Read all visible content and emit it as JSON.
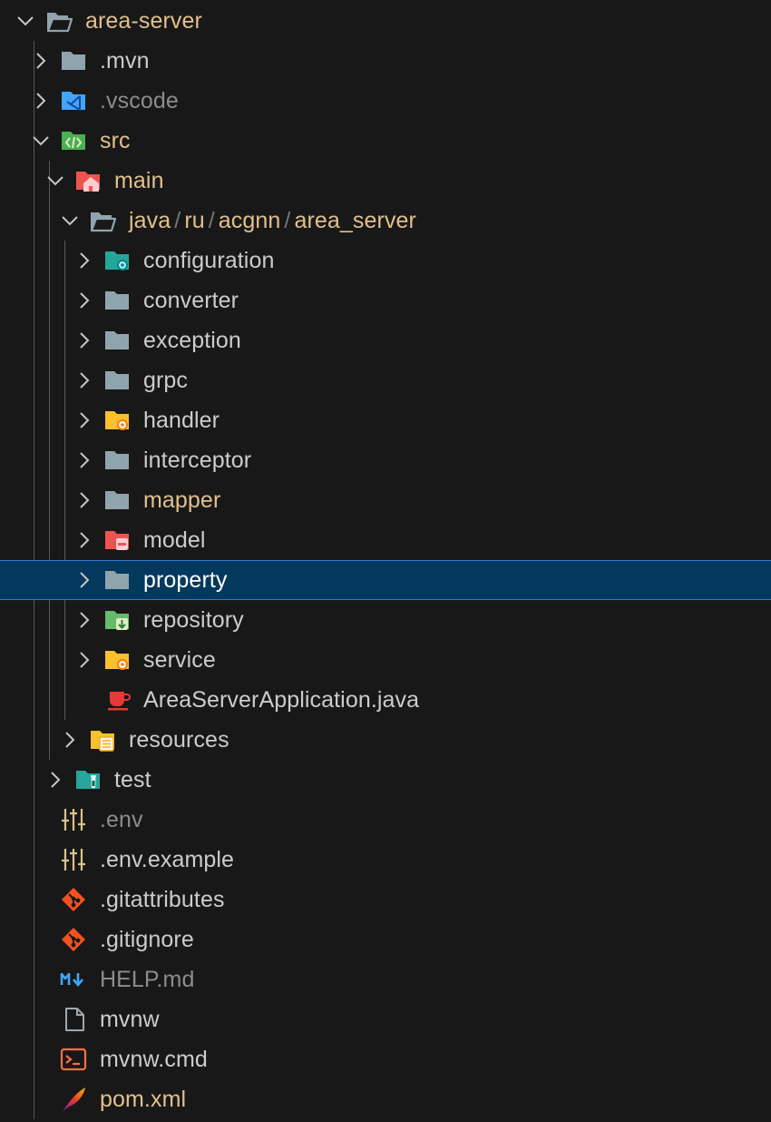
{
  "explorer": {
    "root": {
      "label": "area-server",
      "expanded": true
    },
    "items": [
      {
        "label": ".mvn",
        "icon": "folder-icon",
        "expanded": false
      },
      {
        "label": ".vscode",
        "icon": "vscode-folder-icon",
        "expanded": false
      },
      {
        "label": "src",
        "icon": "src-folder-icon",
        "expanded": true
      },
      {
        "label": "main",
        "icon": "main-folder-icon",
        "expanded": true
      },
      {
        "path": [
          "java",
          "ru",
          "acgnn",
          "area_server"
        ],
        "separator": "/",
        "icon": "folder-open-icon",
        "expanded": true
      },
      {
        "label": "configuration",
        "icon": "config-folder-icon",
        "expanded": false
      },
      {
        "label": "converter",
        "icon": "folder-icon",
        "expanded": false
      },
      {
        "label": "exception",
        "icon": "folder-icon",
        "expanded": false
      },
      {
        "label": "grpc",
        "icon": "folder-icon",
        "expanded": false
      },
      {
        "label": "handler",
        "icon": "handler-folder-icon",
        "expanded": false
      },
      {
        "label": "interceptor",
        "icon": "folder-icon",
        "expanded": false
      },
      {
        "label": "mapper",
        "icon": "folder-icon",
        "expanded": false
      },
      {
        "label": "model",
        "icon": "model-folder-icon",
        "expanded": false
      },
      {
        "label": "property",
        "icon": "folder-icon",
        "expanded": false,
        "selected": true
      },
      {
        "label": "repository",
        "icon": "repository-folder-icon",
        "expanded": false
      },
      {
        "label": "service",
        "icon": "service-folder-icon",
        "expanded": false
      },
      {
        "label": "AreaServerApplication.java",
        "icon": "java-file-icon"
      },
      {
        "label": "resources",
        "icon": "resources-folder-icon",
        "expanded": false
      },
      {
        "label": "test",
        "icon": "test-folder-icon",
        "expanded": false
      },
      {
        "label": ".env",
        "icon": "env-file-icon"
      },
      {
        "label": ".env.example",
        "icon": "env-file-icon"
      },
      {
        "label": ".gitattributes",
        "icon": "git-file-icon"
      },
      {
        "label": ".gitignore",
        "icon": "git-file-icon"
      },
      {
        "label": "HELP.md",
        "icon": "markdown-file-icon"
      },
      {
        "label": "mvnw",
        "icon": "file-icon"
      },
      {
        "label": "mvnw.cmd",
        "icon": "console-file-icon"
      },
      {
        "label": "pom.xml",
        "icon": "maven-file-icon"
      }
    ]
  },
  "colors": {
    "background": "#181818",
    "selection": "#04395e",
    "selection_border": "#2b79d8",
    "modified": "#e2c08d",
    "untracked": "#73c991",
    "ignored": "#8c8c8c"
  }
}
